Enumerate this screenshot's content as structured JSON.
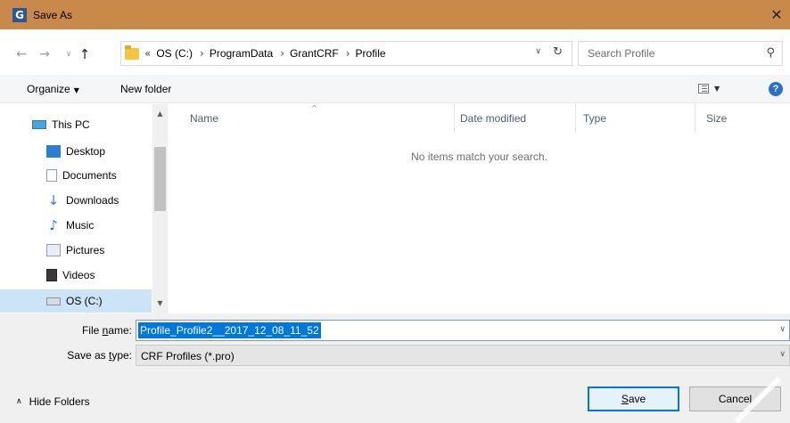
{
  "window": {
    "app_icon_letter": "G",
    "title": "Save As",
    "close_glyph": "✕"
  },
  "nav": {
    "back_glyph": "←",
    "forward_glyph": "→",
    "recent_glyph": "∨",
    "up_glyph": "↑"
  },
  "address": {
    "overflow_glyph": "«",
    "crumbs": [
      "OS (C:)",
      "ProgramData",
      "GrantCRF",
      "Profile"
    ],
    "separator": "›",
    "dropdown_glyph": "∨",
    "refresh_glyph": "↻"
  },
  "search": {
    "placeholder": "Search Profile",
    "icon_glyph": "⚲"
  },
  "toolbar": {
    "organize_label": "Organize",
    "organize_caret": "▼",
    "new_folder_label": "New folder",
    "view_caret": "▼",
    "help_glyph": "?"
  },
  "sidebar": {
    "items": [
      {
        "label": "This PC",
        "icon": "computer-icon"
      },
      {
        "label": "Desktop",
        "icon": "desktop-folder-icon"
      },
      {
        "label": "Documents",
        "icon": "documents-icon"
      },
      {
        "label": "Downloads",
        "icon": "download-arrow-icon"
      },
      {
        "label": "Music",
        "icon": "music-note-icon"
      },
      {
        "label": "Pictures",
        "icon": "pictures-icon"
      },
      {
        "label": "Videos",
        "icon": "video-film-icon"
      },
      {
        "label": "OS (C:)",
        "icon": "drive-icon"
      }
    ],
    "scroll_up_glyph": "▲",
    "scroll_down_glyph": "▼"
  },
  "filelist": {
    "columns": [
      "Name",
      "Date modified",
      "Type",
      "Size"
    ],
    "sort_glyph": "^",
    "empty_message": "No items match your search."
  },
  "form": {
    "file_name_label_pre": "File ",
    "file_name_label_u": "n",
    "file_name_label_post": "ame:",
    "file_name_value": "Profile_Profile2__2017_12_08_11_52",
    "save_type_label_pre": "Save as ",
    "save_type_label_u": "t",
    "save_type_label_post": "ype:",
    "save_type_value": "CRF Profiles (*.pro)",
    "dropdown_glyph": "∨"
  },
  "footer": {
    "hide_folders_caret": "∧",
    "hide_folders_label": "Hide Folders",
    "save_label_u": "S",
    "save_label_rest": "ave",
    "cancel_label": "Cancel"
  },
  "colors": {
    "titlebar": "#c8894a",
    "accent": "#0078d7",
    "selection": "#cce4f7"
  }
}
